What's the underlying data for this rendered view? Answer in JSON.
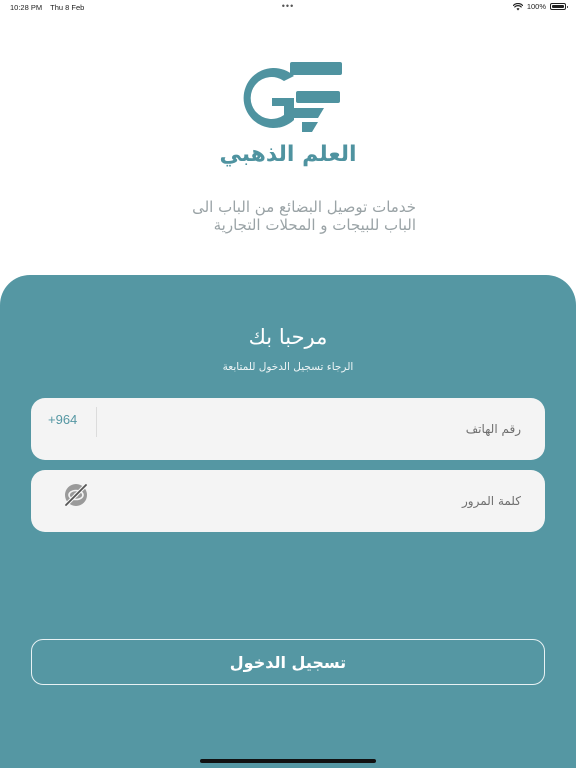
{
  "status_bar": {
    "time": "10:28 PM",
    "date": "Thu 8 Feb",
    "dots": "•••",
    "battery_text": "100%",
    "battery_level": 1.0
  },
  "brand": {
    "name": "العلم الذهبي",
    "color": "#4f93a0",
    "logo_icon": "ge-monogram-logo"
  },
  "tagline": {
    "line1": "خدمات توصيل البضائع من الباب الى",
    "line2": "الباب للبيجات و المحلات التجارية"
  },
  "login": {
    "title": "مرحبا بك",
    "subtitle": "الرجاء تسجيل الدخول للمتابعة",
    "phone": {
      "placeholder": "رقم الهاتف",
      "value": "",
      "country_code": "+964"
    },
    "password": {
      "placeholder": "كلمة المرور",
      "value": "",
      "toggle_icon": "eye-slash-icon"
    },
    "submit_label": "تسجيل الدخول"
  },
  "colors": {
    "card": "#5597a3",
    "field": "#f4f4f4",
    "tagline": "#9aa3a6"
  }
}
